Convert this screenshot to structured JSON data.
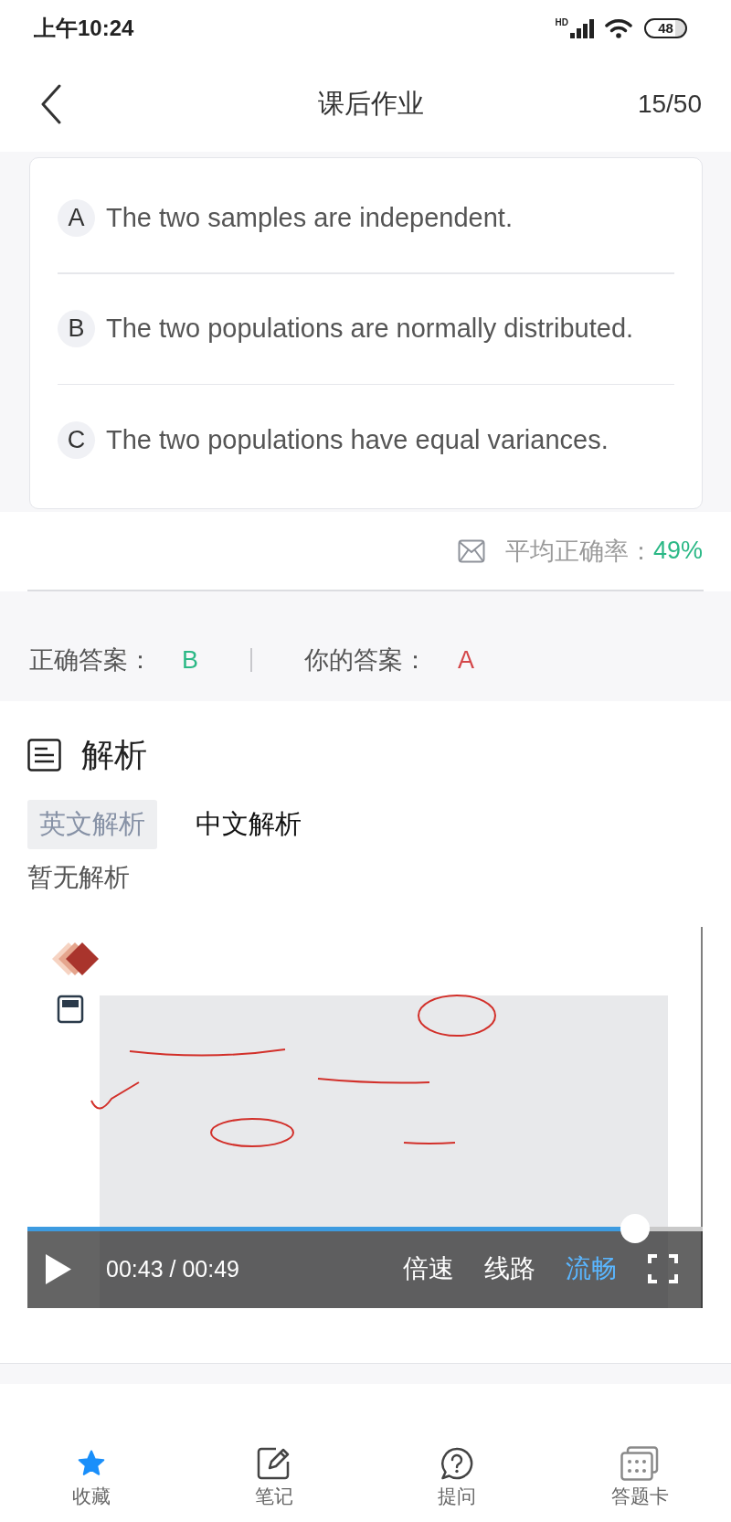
{
  "status_bar": {
    "time": "上午10:24",
    "network": "HD",
    "battery": "48"
  },
  "header": {
    "title": "课后作业",
    "counter": "15/50"
  },
  "options": [
    {
      "letter": "A",
      "text": "The two samples are independent."
    },
    {
      "letter": "B",
      "text": "The two populations are normally distributed."
    },
    {
      "letter": "C",
      "text": "The two populations have equal variances."
    }
  ],
  "stats": {
    "label": "平均正确率：",
    "value": "49%"
  },
  "answers": {
    "correct_label": "正确答案：",
    "correct": "B",
    "yours_label": "你的答案：",
    "yours": "A"
  },
  "analysis": {
    "title": "解析",
    "tabs": [
      {
        "label": "英文解析",
        "selected": true
      },
      {
        "label": "中文解析",
        "selected": false
      }
    ],
    "content": "暂无解析"
  },
  "video": {
    "playing": false,
    "time": "00:43 / 00:49",
    "level": 0.9,
    "controls": [
      {
        "label": "倍速",
        "selected": false
      },
      {
        "label": "线路",
        "selected": false
      },
      {
        "label": "流畅",
        "selected": true
      }
    ]
  },
  "bottom_nav": [
    {
      "label": "收藏",
      "kind": "star",
      "on": true
    },
    {
      "label": "笔记",
      "kind": "note",
      "on": false
    },
    {
      "label": "提问",
      "kind": "question",
      "on": false
    },
    {
      "label": "答题卡",
      "kind": "card",
      "on": false
    }
  ]
}
